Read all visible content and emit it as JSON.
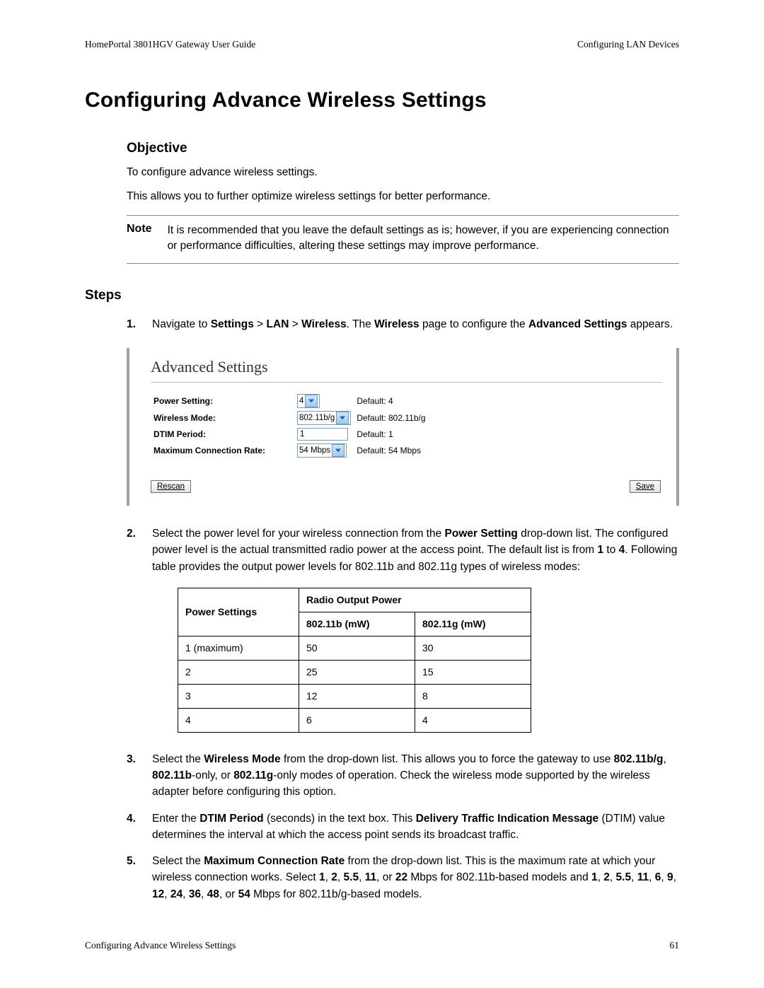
{
  "header": {
    "left": "HomePortal 3801HGV Gateway User Guide",
    "right": "Configuring LAN Devices"
  },
  "title": "Configuring Advance Wireless Settings",
  "objective": {
    "heading": "Objective",
    "p1": "To configure advance wireless settings.",
    "p2": "This allows you to further optimize wireless settings for better performance."
  },
  "note": {
    "label": "Note",
    "text": "It is recommended that you leave the default settings as is; however, if you are experiencing connection or performance difficulties, altering these settings may improve performance."
  },
  "steps_heading": "Steps",
  "step1": {
    "num": "1.",
    "t1": "Navigate to ",
    "b1": "Settings",
    "t2": " > ",
    "b2": "LAN",
    "t3": " > ",
    "b3": "Wireless",
    "t4": ". The ",
    "b4": "Wireless",
    "t5": " page to configure the ",
    "b5": "Advanced Settings",
    "t6": " appears."
  },
  "shot": {
    "title": "Advanced Settings",
    "rows": {
      "power": {
        "label": "Power Setting:",
        "value": "4",
        "default": "Default: 4"
      },
      "mode": {
        "label": "Wireless Mode:",
        "value": "802.11b/g",
        "default": "Default: 802.11b/g"
      },
      "dtim": {
        "label": "DTIM Period:",
        "value": "1",
        "default": "Default: 1"
      },
      "rate": {
        "label": "Maximum Connection Rate:",
        "value": "54 Mbps",
        "default": "Default: 54 Mbps"
      }
    },
    "rescan": "Rescan",
    "save": "Save"
  },
  "step2": {
    "num": "2.",
    "t1": "Select the power level for your wireless connection from the ",
    "b1": "Power Setting",
    "t2": " drop-down list. The configured power level is the actual transmitted radio power at the access point. The default list is from ",
    "b2": "1",
    "t3": " to ",
    "b3": "4",
    "t4": ". Following table provides the output power levels for 802.11b and 802.11g types of wireless modes:"
  },
  "table": {
    "h_settings": "Power Settings",
    "h_output": "Radio Output Power",
    "h_b": "802.11b (mW)",
    "h_g": "802.11g (mW)",
    "rows": [
      {
        "s": "1 (maximum)",
        "b": "50",
        "g": "30"
      },
      {
        "s": "2",
        "b": "25",
        "g": "15"
      },
      {
        "s": "3",
        "b": "12",
        "g": "8"
      },
      {
        "s": "4",
        "b": "6",
        "g": "4"
      }
    ]
  },
  "step3": {
    "num": "3.",
    "t1": "Select the ",
    "b1": "Wireless Mode",
    "t2": " from the drop-down list. This allows you to force the gateway to use ",
    "b2": "802.11b/g",
    "t3": ", ",
    "b3": "802.11b",
    "t4": "-only, or ",
    "b4": "802.11g",
    "t5": "-only modes of operation. Check the wireless mode supported by the wireless adapter before configuring this option."
  },
  "step4": {
    "num": "4.",
    "t1": "Enter the ",
    "b1": "DTIM Period",
    "t2": " (seconds) in the text box. This ",
    "b2": "Delivery Traffic Indication Message",
    "t3": " (DTIM) value determines the interval at which the access point sends its broadcast traffic."
  },
  "step5": {
    "num": "5.",
    "t1": "Select the ",
    "b1": "Maximum Connection Rate",
    "t2": " from the drop-down list. This is the maximum rate at which your wireless connection works. Select ",
    "b2": "1",
    "c1": ", ",
    "b3": "2",
    "c2": ", ",
    "b4": "5.5",
    "c3": ", ",
    "b5": "11",
    "c4": ", or ",
    "b6": "22",
    "t3": " Mbps for 802.11b-based models and ",
    "b7": "1",
    "d1": ", ",
    "b8": "2",
    "d2": ", ",
    "b9": "5.5",
    "d3": ", ",
    "b10": "11",
    "d4": ", ",
    "b11": "6",
    "d5": ", ",
    "b12": "9",
    "d6": ", ",
    "b13": "12",
    "d7": ", ",
    "b14": "24",
    "d8": ", ",
    "b15": "36",
    "d9": ", ",
    "b16": "48",
    "d10": ", or ",
    "b17": "54",
    "t4": " Mbps for 802.11b/g-based models."
  },
  "footer": {
    "left": "Configuring Advance Wireless Settings",
    "right": "61"
  },
  "chart_data": {
    "type": "table",
    "title": "Radio Output Power by Power Setting",
    "columns": [
      "Power Settings",
      "802.11b (mW)",
      "802.11g (mW)"
    ],
    "rows": [
      [
        "1 (maximum)",
        50,
        30
      ],
      [
        "2",
        25,
        15
      ],
      [
        "3",
        12,
        8
      ],
      [
        "4",
        6,
        4
      ]
    ]
  }
}
